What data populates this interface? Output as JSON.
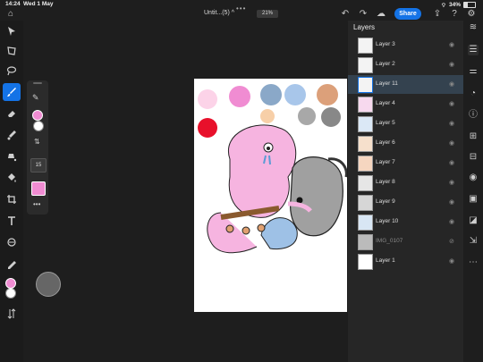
{
  "status": {
    "time": "14:24",
    "date": "Wed 1 May",
    "battery": "34%"
  },
  "topbar": {
    "title": "Untit...(5)",
    "title_caret": "^",
    "zoom": "21%",
    "share": "Share"
  },
  "layers_panel": {
    "title": "Layers",
    "items": [
      {
        "label": "Layer 3"
      },
      {
        "label": "Layer 2"
      },
      {
        "label": "Layer 11"
      },
      {
        "label": "Layer 4"
      },
      {
        "label": "Layer 5"
      },
      {
        "label": "Layer 6"
      },
      {
        "label": "Layer 7"
      },
      {
        "label": "Layer 8"
      },
      {
        "label": "Layer 9"
      },
      {
        "label": "Layer 10"
      },
      {
        "label": "IMG_0107"
      },
      {
        "label": "Layer 1"
      }
    ]
  },
  "brush": {
    "size": "15"
  },
  "colors": {
    "accent": "#1473e6",
    "foreground": "#f08cd2",
    "background": "#ffffff"
  }
}
